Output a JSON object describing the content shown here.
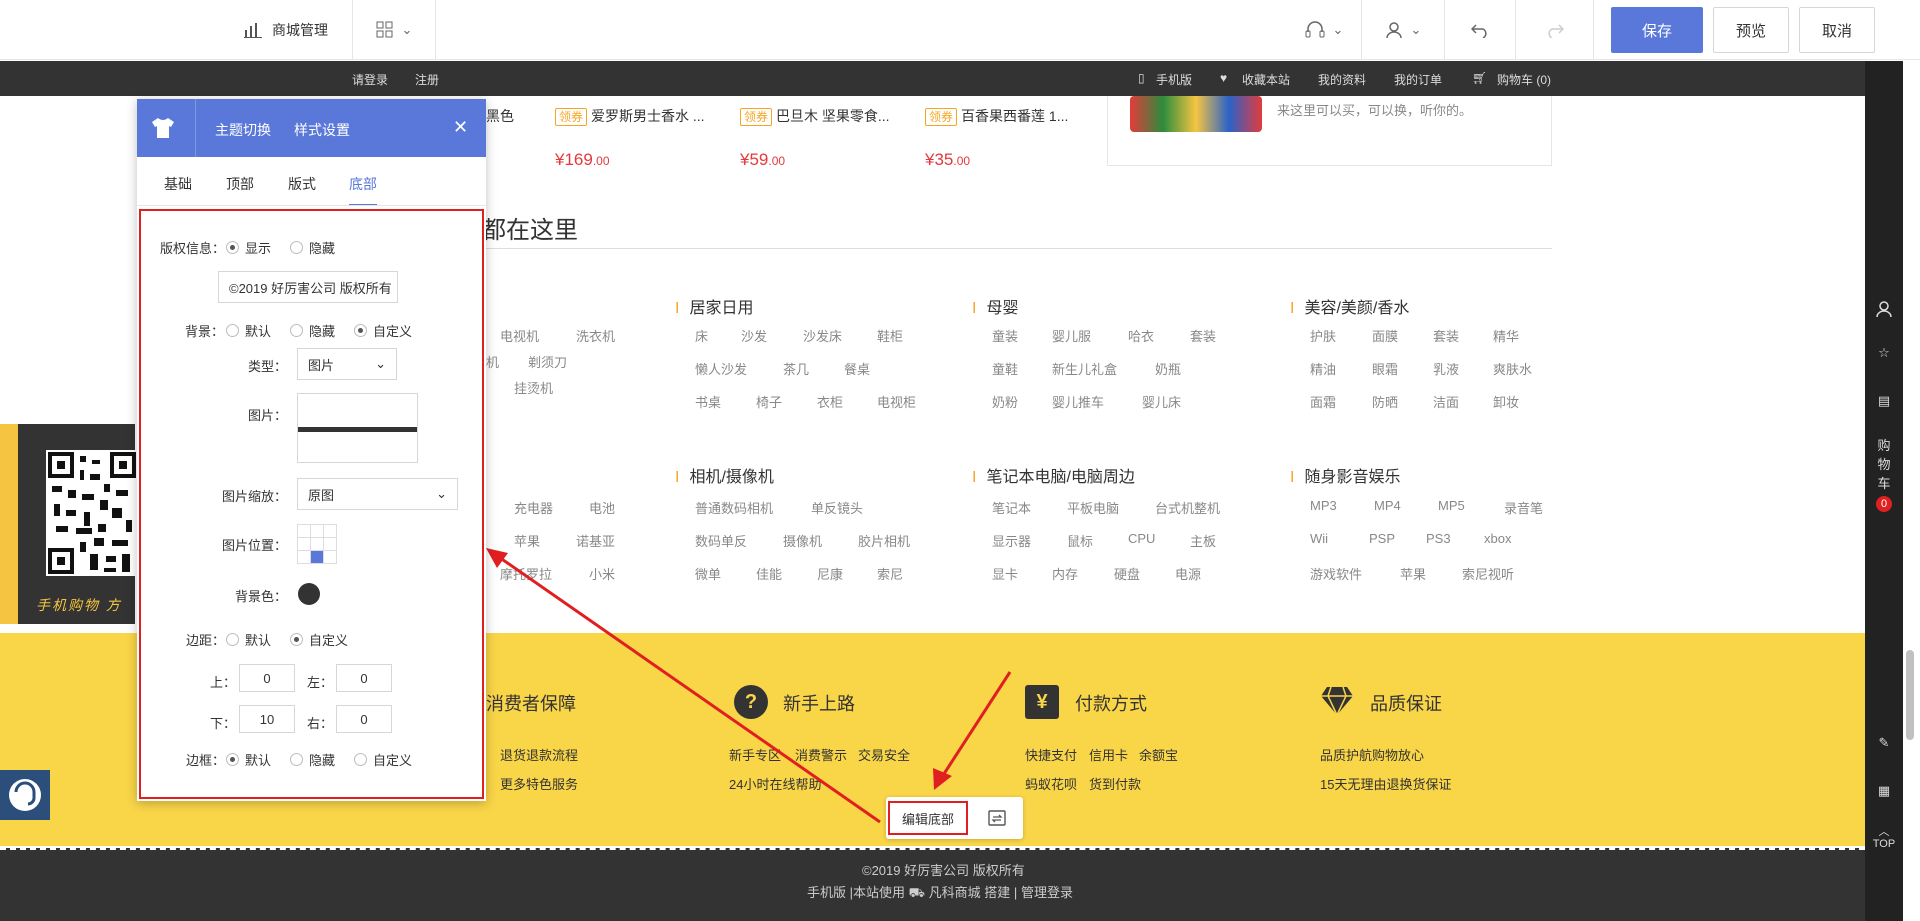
{
  "toolbar": {
    "mall_label": "商城管理",
    "save": "保存",
    "preview": "预览",
    "cancel": "取消"
  },
  "sitenav": {
    "login": "请登录",
    "register": "注册",
    "mobile": "手机版",
    "favorite": "收藏本站",
    "profile": "我的资料",
    "orders": "我的订单",
    "cart": "购物车 (0)"
  },
  "rail": {
    "cart": [
      "购",
      "物",
      "车"
    ],
    "cart_count": "0",
    "top": "TOP"
  },
  "products": [
    {
      "title_pre": "黑色",
      "coupon": "",
      "price": ""
    },
    {
      "coupon": "领券",
      "title": "爱罗斯男士香水 ...",
      "price_int": "¥169",
      "price_dec": ".00"
    },
    {
      "coupon": "领券",
      "title": "巴旦木 坚果零食...",
      "price_int": "¥59",
      "price_dec": ".00"
    },
    {
      "coupon": "领券",
      "title": "百香果西番莲 1...",
      "price_int": "¥35",
      "price_dec": ".00"
    }
  ],
  "promo_text": "来这里可以买，可以换，听你的。",
  "section_title": "都在这里",
  "categories_left": [
    [
      "电视机",
      "洗衣机"
    ],
    [
      "机",
      "剃须刀"
    ],
    [
      "挂烫机"
    ],
    [
      "充电器",
      "电池"
    ],
    [
      "苹果",
      "诺基亚"
    ],
    [
      "摩托罗拉",
      "小米"
    ]
  ],
  "categories": [
    {
      "title": "居家日用",
      "rows": [
        [
          "床",
          "沙发",
          "沙发床",
          "鞋柜"
        ],
        [
          "懒人沙发",
          "茶几",
          "餐桌"
        ],
        [
          "书桌",
          "椅子",
          "衣柜",
          "电视柜"
        ]
      ]
    },
    {
      "title": "母婴",
      "rows": [
        [
          "童装",
          "婴儿服",
          "哈衣",
          "套装"
        ],
        [
          "童鞋",
          "新生儿礼盒",
          "奶瓶"
        ],
        [
          "奶粉",
          "婴儿推车",
          "婴儿床"
        ]
      ]
    },
    {
      "title": "美容/美颜/香水",
      "rows": [
        [
          "护肤",
          "面膜",
          "套装",
          "精华"
        ],
        [
          "精油",
          "眼霜",
          "乳液",
          "爽肤水"
        ],
        [
          "面霜",
          "防晒",
          "洁面",
          "卸妆"
        ]
      ]
    },
    {
      "title": "相机/摄像机",
      "rows": [
        [
          "普通数码相机",
          "单反镜头"
        ],
        [
          "数码单反",
          "摄像机",
          "胶片相机"
        ],
        [
          "微单",
          "佳能",
          "尼康",
          "索尼"
        ]
      ]
    },
    {
      "title": "笔记本电脑/电脑周边",
      "rows": [
        [
          "笔记本",
          "平板电脑",
          "台式机整机"
        ],
        [
          "显示器",
          "鼠标",
          "CPU",
          "主板"
        ],
        [
          "显卡",
          "内存",
          "硬盘",
          "电源"
        ]
      ]
    },
    {
      "title": "随身影音娱乐",
      "rows": [
        [
          "MP3",
          "MP4",
          "MP5",
          "录音笔"
        ],
        [
          "Wii",
          "PSP",
          "PS3",
          "xbox"
        ],
        [
          "游戏软件",
          "苹果",
          "索尼视听"
        ]
      ]
    }
  ],
  "qr_text": "手机购物 方",
  "features": [
    {
      "icon": "",
      "title": "消费者保障",
      "lines": [
        [
          "退货退款流程"
        ],
        [
          "更多特色服务"
        ]
      ]
    },
    {
      "icon": "?",
      "title": "新手上路",
      "lines": [
        [
          "新手专区",
          "消费警示",
          "交易安全"
        ],
        [
          "24小时在线帮助"
        ]
      ]
    },
    {
      "icon": "¥",
      "title": "付款方式",
      "lines": [
        [
          "快捷支付",
          "信用卡",
          "余额宝"
        ],
        [
          "蚂蚁花呗",
          "货到付款"
        ]
      ]
    },
    {
      "icon": "",
      "title": "品质保证",
      "lines": [
        [
          "品质护航购物放心"
        ],
        [
          "15天无理由退换货保证"
        ]
      ]
    }
  ],
  "footer": {
    "copyright": "©2019 好厉害公司 版权所有",
    "line2": [
      "手机版",
      "|本站使用",
      "凡科商城",
      "搭建",
      "|",
      "管理登录"
    ]
  },
  "edit_footer": "编辑底部",
  "panel": {
    "tabs": [
      "主题切换",
      "样式设置"
    ],
    "sub_tabs": [
      "基础",
      "顶部",
      "版式",
      "底部"
    ],
    "copyright_label": "版权信息：",
    "show": "显示",
    "hide": "隐藏",
    "copyright_value": "©2019 好厉害公司 版权所有",
    "bg_label": "背景：",
    "default": "默认",
    "custom": "自定义",
    "type_label": "类型：",
    "type_value": "图片",
    "image_label": "图片：",
    "scale_label": "图片缩放：",
    "scale_value": "原图",
    "position_label": "图片位置：",
    "bgcolor_label": "背景色：",
    "bgcolor": "#333333",
    "margin_label": "边距：",
    "top_label": "上：",
    "top_value": "0",
    "left_label": "左：",
    "left_value": "0",
    "bottom_label": "下：",
    "bottom_value": "10",
    "right_label": "右：",
    "right_value": "0",
    "border_label": "边框："
  },
  "colors": {
    "accent": "#5a78d9",
    "highlight_red": "#e02020",
    "footer_yellow": "#f9d548",
    "price_red": "#e4393c"
  }
}
